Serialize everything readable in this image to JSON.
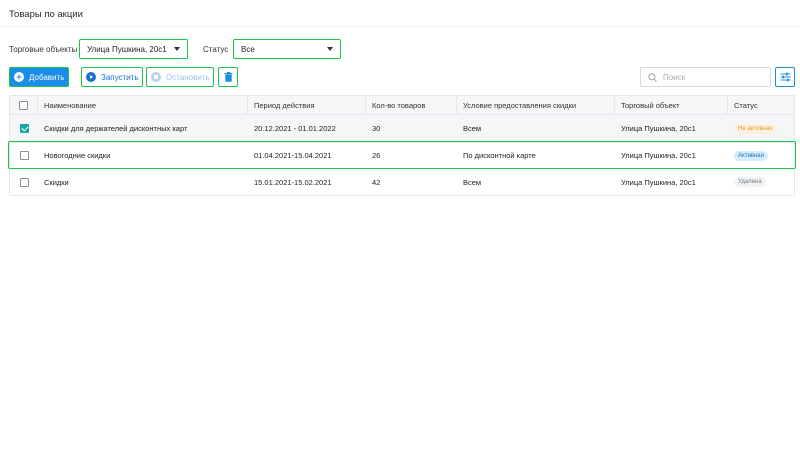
{
  "page": {
    "title": "Товары по акции"
  },
  "filters": {
    "store_label": "Торговые объекты",
    "store_value": "Улица Пушкина, 20с1",
    "status_label": "Статус",
    "status_value": "Все"
  },
  "toolbar": {
    "add_label": "Добавить",
    "start_label": "Запустить",
    "stop_label": "Остановить",
    "delete_icon": "trash-icon",
    "search_placeholder": "Поиск",
    "filter_icon": "sliders-icon"
  },
  "table": {
    "columns": [
      "Наименование",
      "Период действия",
      "Кол-во товаров",
      "Условие предоставления скидки",
      "Торговый объект",
      "Статус"
    ],
    "rows": [
      {
        "checked": true,
        "name": "Скидки для держателей дисконтных карт",
        "period": "20.12.2021 - 01.01.2022",
        "count": "30",
        "condition": "Всем",
        "store": "Улица Пушкина, 20с1",
        "status": "Не активная",
        "status_color": "#f09a26"
      },
      {
        "checked": false,
        "name": "Новогодние скидки",
        "period": "01.04.2021-15.04.2021",
        "count": "26",
        "condition": "По дисконтной карте",
        "store": "Улица Пушкина, 20с1",
        "status": "Активная",
        "status_color": "#1a77c9"
      },
      {
        "checked": false,
        "name": "Скидки",
        "period": "15.01.2021-15.02.2021",
        "count": "42",
        "condition": "Всем",
        "store": "Улица Пушкина, 20с1",
        "status": "Удалена",
        "status_color": "#7a8088"
      }
    ]
  },
  "colors": {
    "accent": "#1a8ee6",
    "highlight": "#1ec34a",
    "checkbox_checked": "#1aa9a0"
  }
}
